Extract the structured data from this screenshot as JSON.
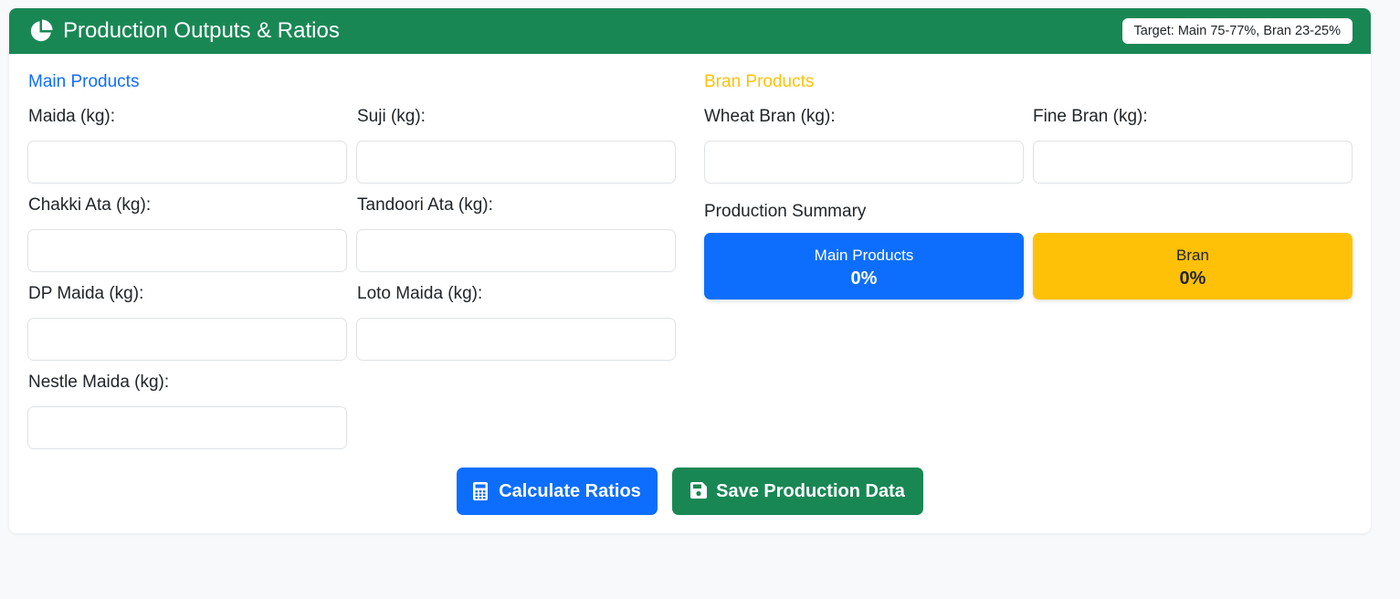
{
  "header": {
    "title": "Production Outputs & Ratios",
    "icon": "chart-pie-icon",
    "target_badge": "Target: Main 75-77%, Bran 23-25%"
  },
  "main_products": {
    "title": "Main Products",
    "color": "#0d6efd",
    "fields": [
      {
        "label": "Maida (kg):",
        "value": "",
        "placeholder": ""
      },
      {
        "label": "Suji (kg):",
        "value": "",
        "placeholder": ""
      },
      {
        "label": "Chakki Ata (kg):",
        "value": "",
        "placeholder": ""
      },
      {
        "label": "Tandoori Ata (kg):",
        "value": "",
        "placeholder": ""
      },
      {
        "label": "DP Maida (kg):",
        "value": "",
        "placeholder": ""
      },
      {
        "label": "Loto Maida (kg):",
        "value": "",
        "placeholder": ""
      },
      {
        "label": "Nestle Maida (kg):",
        "value": "",
        "placeholder": ""
      }
    ]
  },
  "bran_products": {
    "title": "Bran Products",
    "color": "#ffc107",
    "fields": [
      {
        "label": "Wheat Bran (kg):",
        "value": "",
        "placeholder": ""
      },
      {
        "label": "Fine Bran (kg):",
        "value": "",
        "placeholder": ""
      }
    ]
  },
  "summary": {
    "title": "Production Summary",
    "main": {
      "label": "Main Products",
      "value": "0%",
      "color": "#0d6efd"
    },
    "bran": {
      "label": "Bran",
      "value": "0%",
      "color": "#ffc107"
    }
  },
  "actions": {
    "calculate": {
      "label": "Calculate Ratios",
      "icon": "calculator-icon",
      "color": "#0d6efd"
    },
    "save": {
      "label": "Save Production Data",
      "icon": "floppy-disk-icon",
      "color": "#198754"
    }
  }
}
